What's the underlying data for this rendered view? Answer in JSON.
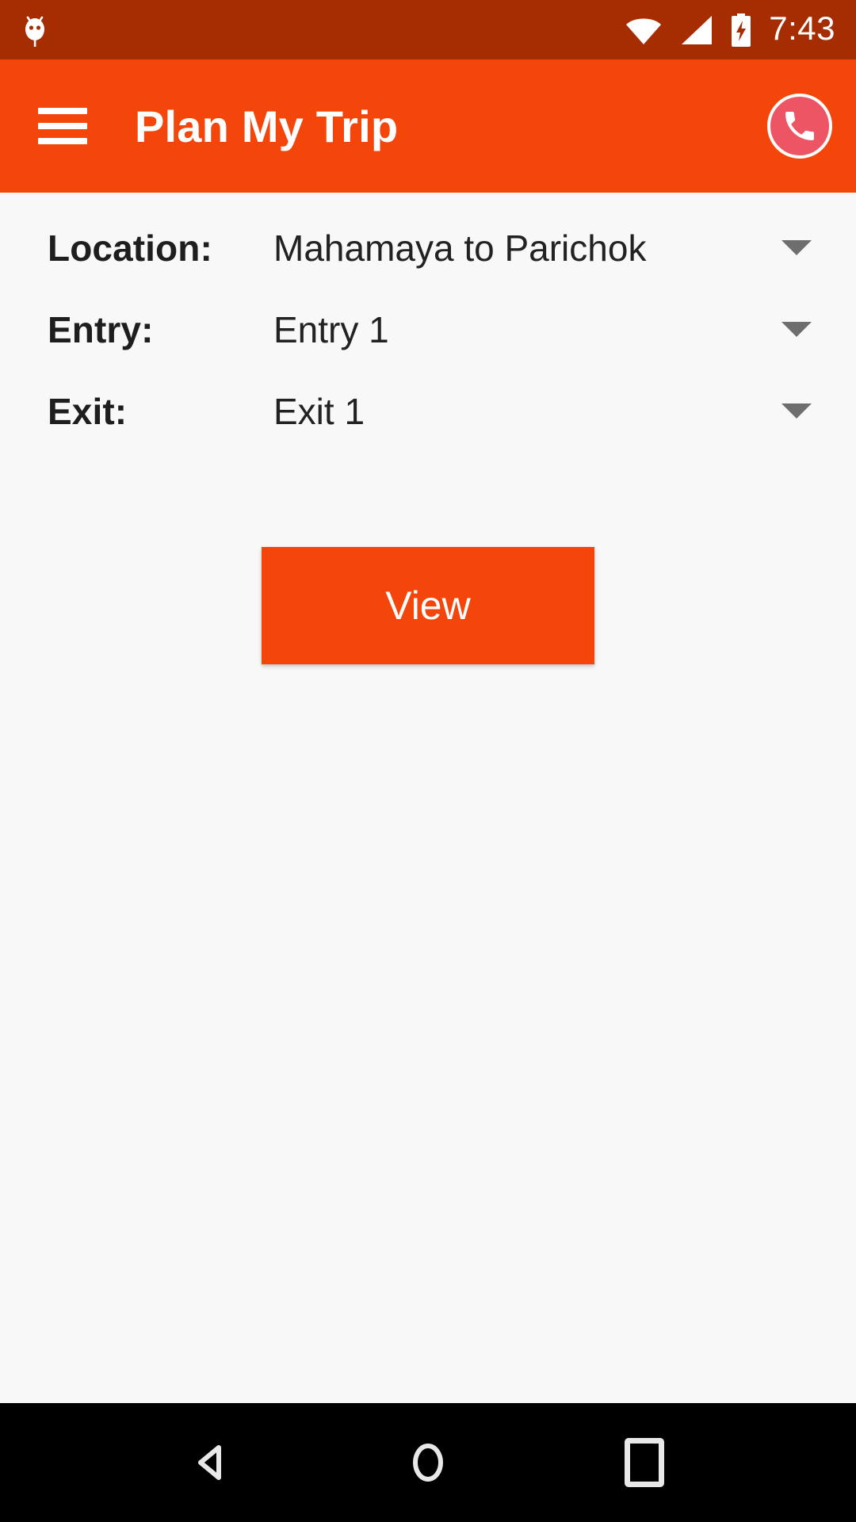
{
  "statusbar": {
    "time": "7:43",
    "notification_icon": "android-bug-icon",
    "icons": [
      "wifi-icon",
      "cellular-signal-icon",
      "battery-charging-icon"
    ],
    "background_color": "#A62D02",
    "foreground_color": "#FFFFFF"
  },
  "appbar": {
    "title": "Plan My Trip",
    "menu_icon": "hamburger-menu-icon",
    "call_icon": "phone-call-icon",
    "background_color": "#F4450A",
    "title_color": "#FFFFFF",
    "call_button_color": "#ED5565"
  },
  "form": {
    "rows": [
      {
        "label": "Location:",
        "value": "Mahamaya to Parichok",
        "caret_icon": "chevron-down-icon"
      },
      {
        "label": "Entry:",
        "value": "Entry 1",
        "caret_icon": "chevron-down-icon"
      },
      {
        "label": "Exit:",
        "value": "Exit 1",
        "caret_icon": "chevron-down-icon"
      }
    ],
    "label_color": "#1E1E1E",
    "value_color": "#222222",
    "caret_color": "#6E6E6E"
  },
  "actions": {
    "view_label": "View",
    "view_background": "#F4450A",
    "view_text_color": "#FFFFFF"
  },
  "navbar": {
    "back_icon": "back-triangle-icon",
    "home_icon": "home-circle-icon",
    "recents_icon": "recents-square-icon",
    "background_color": "#000000",
    "icon_color": "#E8E8E8"
  },
  "page": {
    "background_color": "#F8F8F8"
  }
}
